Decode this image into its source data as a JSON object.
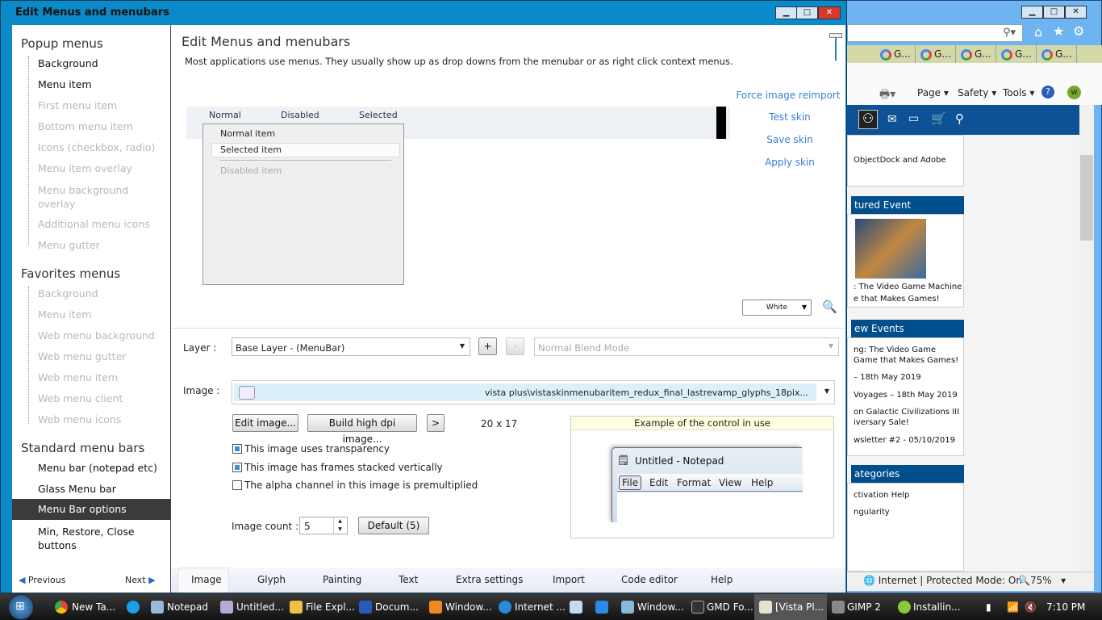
{
  "window": {
    "title": "Edit Menus and menubars",
    "minimize": "▁",
    "maximize": "□",
    "close": "✕"
  },
  "sidebar": {
    "groups": [
      {
        "title": "Popup menus",
        "items": [
          {
            "label": "Background",
            "enabled": true
          },
          {
            "label": "Menu item",
            "enabled": true
          },
          {
            "label": "First menu item",
            "enabled": false
          },
          {
            "label": "Bottom menu item",
            "enabled": false
          },
          {
            "label": "Icons (checkbox, radio)",
            "enabled": false
          },
          {
            "label": "Menu item overlay",
            "enabled": false
          },
          {
            "label": "Menu background overlay",
            "enabled": false
          },
          {
            "label": "Additional menu icons",
            "enabled": false
          },
          {
            "label": "Menu gutter",
            "enabled": false
          }
        ]
      },
      {
        "title": "Favorites menus",
        "items": [
          {
            "label": "Background",
            "enabled": false
          },
          {
            "label": "Menu item",
            "enabled": false
          },
          {
            "label": "Web menu background",
            "enabled": false
          },
          {
            "label": "Web menu gutter",
            "enabled": false
          },
          {
            "label": "Web menu item",
            "enabled": false
          },
          {
            "label": "Web menu client",
            "enabled": false
          },
          {
            "label": "Web menu icons",
            "enabled": false
          }
        ]
      },
      {
        "title": "Standard menu bars",
        "items": [
          {
            "label": "Menu bar (notepad etc)",
            "enabled": true
          },
          {
            "label": "Glass Menu bar",
            "enabled": true
          },
          {
            "label": "Menu Bar options",
            "enabled": true,
            "selected": true
          },
          {
            "label": "Min, Restore, Close buttons",
            "enabled": true
          }
        ]
      }
    ],
    "previous": "Previous",
    "next": "Next"
  },
  "main": {
    "heading": "Edit Menus and menubars",
    "description": "Most applications use menus.  They usually show up as drop downs from the menubar or as right click context menus.",
    "preview": {
      "menubar": [
        "Normal",
        "Disabled",
        "Selected"
      ],
      "popup": [
        "Normal item",
        "Selected item",
        "Disabled item"
      ]
    },
    "actions": [
      "Force image reimport",
      "Test skin",
      "Save skin",
      "Apply skin"
    ],
    "background_select": "White",
    "layer_label": "Layer :",
    "layer_value": "Base Layer - (MenuBar)",
    "add": "+",
    "remove": "-",
    "blend_mode": "Normal Blend Mode",
    "image_label": "Image :",
    "image_value": "vista plus\\vistaskinmenubaritem_redux_final_lastrevamp_glyphs_18pix...",
    "edit_image": "Edit image...",
    "build_hidpi": "Build high dpi image...",
    "more": ">",
    "image_size": "20 x 17",
    "checkboxes": [
      {
        "label": "This image uses transparency",
        "checked": true
      },
      {
        "label": "This image has frames stacked vertically",
        "checked": true
      },
      {
        "label": "The alpha channel in this image is premultiplied",
        "checked": false
      }
    ],
    "image_count_label": "Image count :",
    "image_count": "5",
    "default_button": "Default (5)",
    "example": {
      "title": "Example of the control in use",
      "np_title": "Untitled - Notepad",
      "np_menu": [
        "File",
        "Edit",
        "Format",
        "View",
        "Help"
      ]
    },
    "tabs": [
      "Image",
      "Glyph",
      "Painting",
      "Text",
      "Extra settings",
      "Import",
      "Code editor",
      "Help"
    ],
    "active_tab": "Image"
  },
  "browser": {
    "tabs": [
      "G...",
      "G...",
      "G...",
      "G...",
      "G..."
    ],
    "commands": [
      "Page",
      "Safety",
      "Tools"
    ],
    "snippet": "ObjectDock and Adobe",
    "featured_title": "tured Event",
    "featured_caption": [
      ": The Video Game Machine",
      "e that Makes Games!"
    ],
    "events_title": "ew Events",
    "events": [
      "ng: The Video Game",
      "Game that Makes Games!",
      "– 18th May 2019",
      "Voyages – 18th May 2019",
      "on Galactic Civilizations III",
      "iversary Sale!",
      "wsletter #2 - 05/10/2019"
    ],
    "categories_title": "ategories",
    "categories": [
      "ctivation Help",
      "ngularity"
    ],
    "status": "Internet | Protected Mode: On",
    "zoom": "75%"
  },
  "taskbar": {
    "items": [
      "New Ta...",
      "Notepad",
      "Untitled...",
      "File Expl...",
      "Docum...",
      "Window...",
      "Internet ...",
      "Window...",
      "GMD Fo...",
      "[Vista Pl...",
      "GIMP 2",
      "Installin..."
    ],
    "active": "[Vista Pl...",
    "clock": "7:10 PM"
  },
  "colors": {
    "accent": "#0a8ac8",
    "link": "#3a7fd8",
    "selected": "#3b3b3b",
    "ie_blue": "#004e8c"
  }
}
